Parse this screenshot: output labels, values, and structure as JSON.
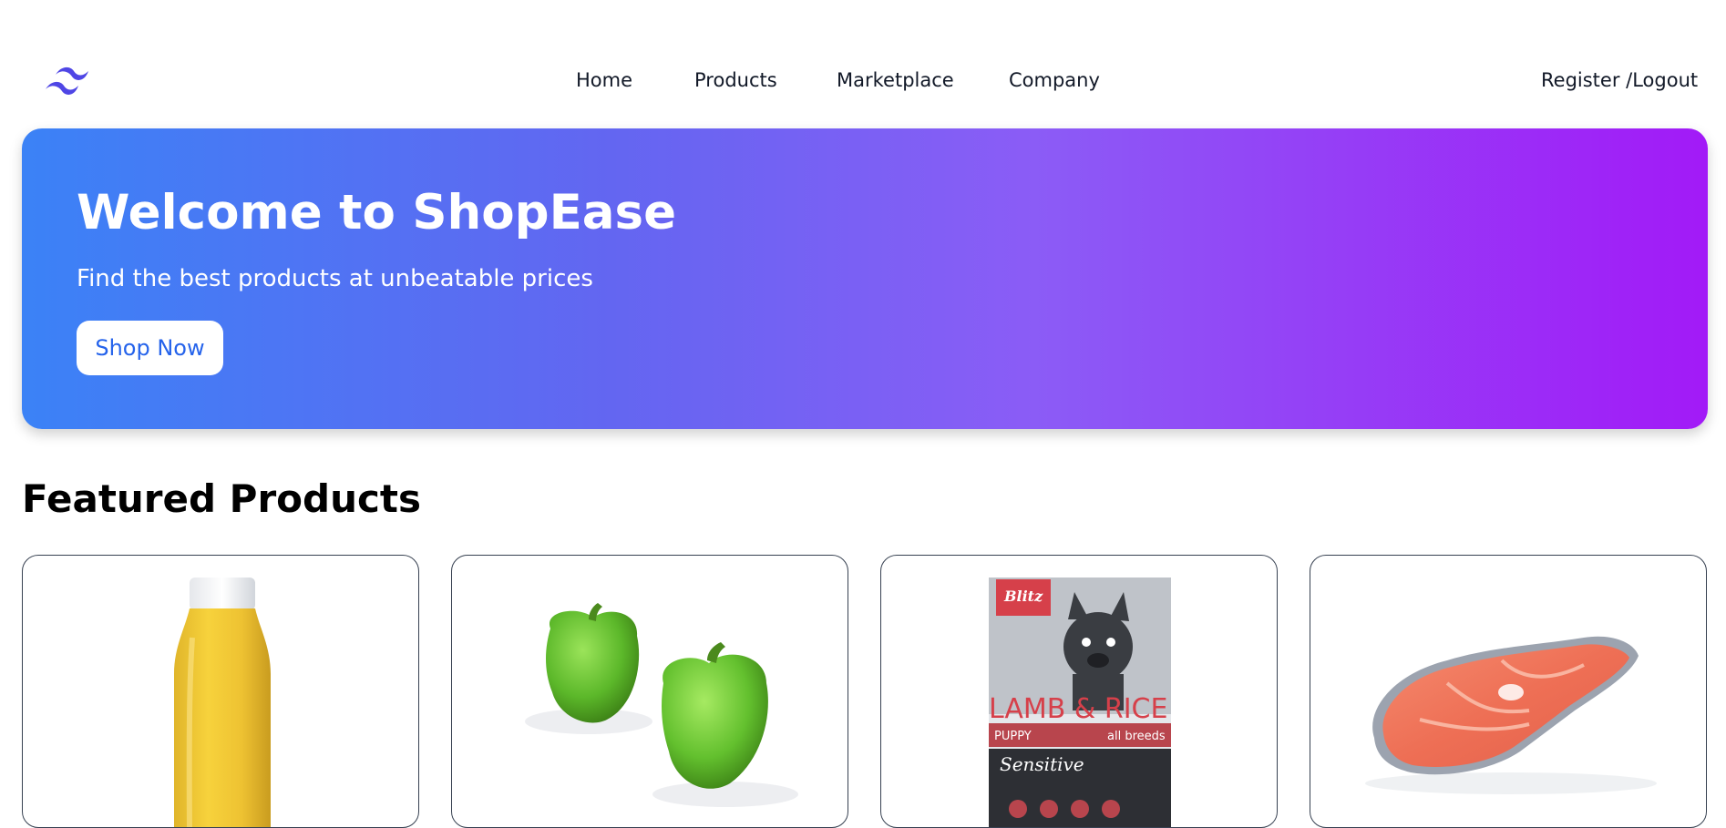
{
  "navbar": {
    "logo_icon": "tailwind-waves-logo",
    "links": [
      {
        "label": "Home"
      },
      {
        "label": "Products"
      },
      {
        "label": "Marketplace"
      },
      {
        "label": "Company"
      }
    ],
    "auth_label": "Register /Logout"
  },
  "hero": {
    "title": "Welcome to ShopEase",
    "subtitle": "Find the best products at unbeatable prices",
    "button_label": "Shop Now",
    "gradient_start": "#3b82f6",
    "gradient_end": "#a21af7",
    "button_text_color": "#2563eb"
  },
  "featured": {
    "title": "Featured Products",
    "products": [
      {
        "image": "juice-bottle-image"
      },
      {
        "image": "green-bell-peppers-image"
      },
      {
        "image": "dog-food-bag-image",
        "bag_brand": "Blitz",
        "bag_title": "LAMB & RICE",
        "bag_sub": "PUPPY",
        "bag_tag": "all breeds",
        "bag_line": "Sensitive"
      },
      {
        "image": "salmon-steak-image"
      }
    ]
  },
  "colors": {
    "accent": "#4f46e5",
    "text": "#111827"
  }
}
